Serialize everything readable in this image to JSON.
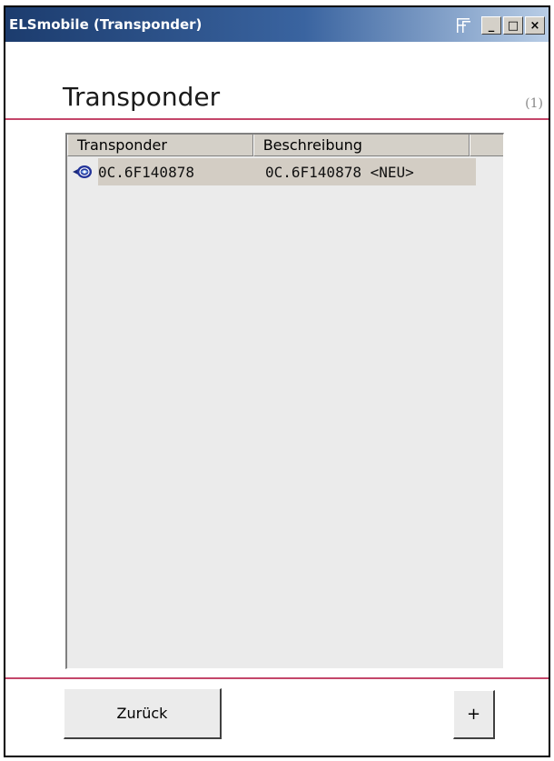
{
  "window": {
    "title": "ELSmobile (Transponder)",
    "controls": {
      "minimize_symbol": "_",
      "maximize_symbol": "□",
      "close_symbol": "×"
    }
  },
  "page": {
    "title": "Transponder",
    "count": "(1)"
  },
  "list": {
    "columns": [
      "Transponder",
      "Beschreibung",
      ""
    ],
    "rows": [
      {
        "icon": "transponder-icon",
        "transponder": "0C.6F140878",
        "beschreibung": "0C.6F140878 <NEU>"
      }
    ]
  },
  "buttons": {
    "back_label": "Zurück",
    "add_label": "+"
  },
  "colors": {
    "accent_rule": "#c4466a",
    "titlebar_start": "#1c3c6e",
    "selection_bg": "#d3cdc4"
  }
}
